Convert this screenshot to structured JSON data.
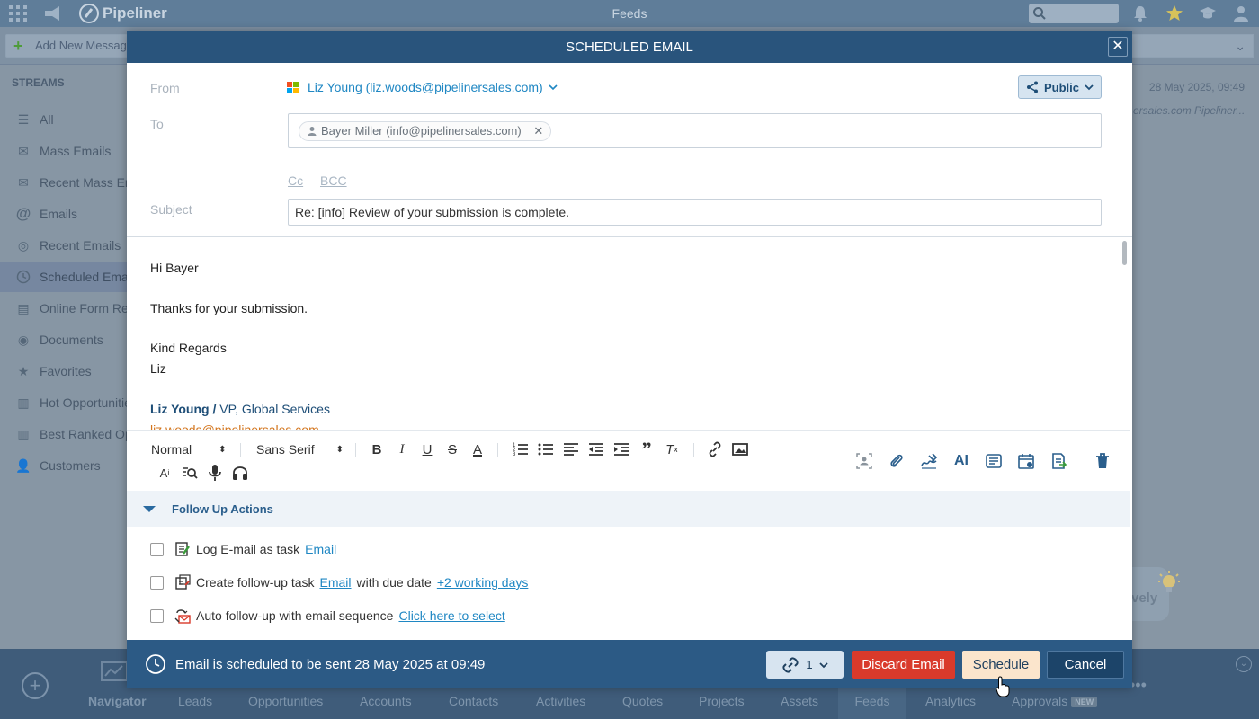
{
  "topbar": {
    "logo_text": "Pipeliner",
    "app_title": "Feeds"
  },
  "subbar": {
    "add_message_label": "Add New Message"
  },
  "sidebar": {
    "title": "STREAMS",
    "items": [
      {
        "label": "All",
        "icon": "list-icon"
      },
      {
        "label": "Mass Emails",
        "icon": "mass-email-icon"
      },
      {
        "label": "Recent Mass Emails",
        "icon": "recent-mass-email-icon"
      },
      {
        "label": "Emails",
        "icon": "at-icon"
      },
      {
        "label": "Recent Emails",
        "icon": "recent-email-icon"
      },
      {
        "label": "Scheduled Emails",
        "icon": "clock-icon",
        "active": true
      },
      {
        "label": "Online Form Responses",
        "icon": "form-icon"
      },
      {
        "label": "Documents",
        "icon": "document-icon"
      },
      {
        "label": "Favorites",
        "icon": "star-icon"
      },
      {
        "label": "Hot Opportunities",
        "icon": "hot-icon"
      },
      {
        "label": "Best Ranked Opportunities",
        "icon": "ranked-icon"
      },
      {
        "label": "Customers",
        "icon": "customers-icon"
      }
    ]
  },
  "feed": {
    "date": "28 May 2025, 09:49",
    "snippet": "ersales.com Pipeliner...",
    "tip_text": "vely"
  },
  "bottom_nav": {
    "items": [
      "Navigator",
      "Leads",
      "Opportunities",
      "Accounts",
      "Contacts",
      "Activities",
      "Quotes",
      "Projects",
      "Assets",
      "Feeds",
      "Analytics",
      "Approvals"
    ],
    "new_badge": "NEW"
  },
  "modal": {
    "title": "SCHEDULED EMAIL",
    "from_label": "From",
    "from_value": "Liz Young (liz.woods@pipelinersales.com)",
    "visibility": "Public",
    "to_label": "To",
    "to_recipient": "Bayer Miller (info@pipelinersales.com)",
    "cc_label": "Cc",
    "bcc_label": "BCC",
    "subject_label": "Subject",
    "subject_value": "Re: [info] Review of your submission is complete.",
    "body": {
      "greeting": "Hi Bayer",
      "line1": "Thanks for your submission.",
      "closing": "Kind Regards",
      "name": "Liz",
      "sig_name": "Liz Young",
      "sig_role": "VP, Global Services",
      "sig_email": "liz.woods@pipelinersales.com"
    },
    "toolbar": {
      "format_select": "Normal",
      "font_select": "Sans Serif"
    },
    "followup": {
      "title": "Follow Up Actions",
      "rows": [
        {
          "text": "Log E-mail as task",
          "link1": "Email"
        },
        {
          "text": "Create follow-up task",
          "link1": "Email",
          "mid": "with due date",
          "link2": "+2 working days"
        },
        {
          "text": "Auto follow-up with email sequence",
          "link1": "Click here to select"
        }
      ]
    },
    "footer": {
      "schedule_info": "Email is scheduled to be sent 28 May 2025 at 09:49",
      "attachments_count": "1",
      "discard_label": "Discard Email",
      "schedule_label": "Schedule",
      "cancel_label": "Cancel"
    }
  },
  "colors": {
    "header_bg": "#29547c",
    "footer_bg": "#2c5a85",
    "discard_bg": "#d93a2b",
    "schedule_bg": "#fbe5cc",
    "link": "#1f87c3"
  }
}
